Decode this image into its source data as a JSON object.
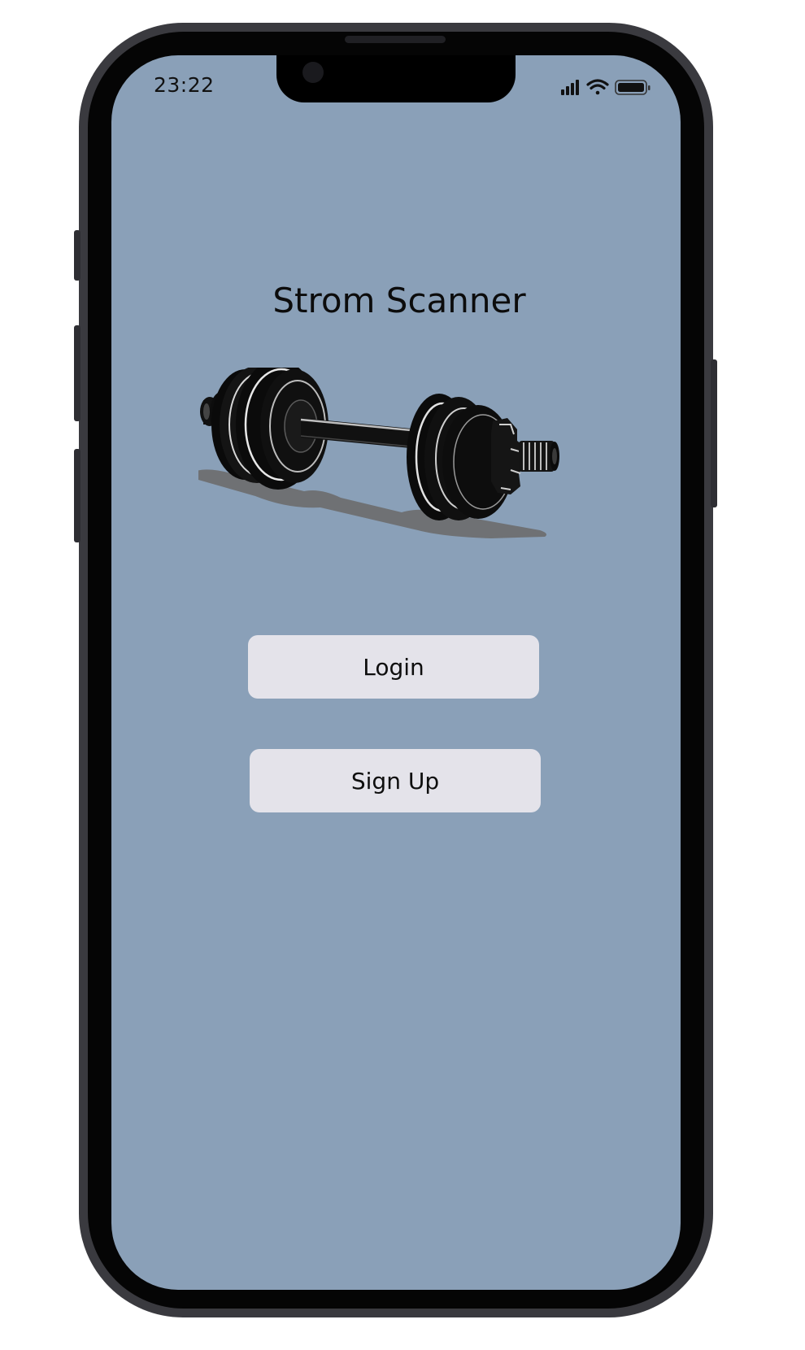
{
  "status_bar": {
    "time": "23:22",
    "icons": [
      "cellular-signal-icon",
      "wifi-icon",
      "battery-icon"
    ]
  },
  "app": {
    "title": "Strom Scanner",
    "logo": "dumbbell-icon"
  },
  "actions": {
    "login_label": "Login",
    "signup_label": "Sign Up"
  },
  "colors": {
    "screen_background": "#8aa0b8",
    "button_background": "#e4e3ea",
    "frame": "#3a3a3f"
  }
}
